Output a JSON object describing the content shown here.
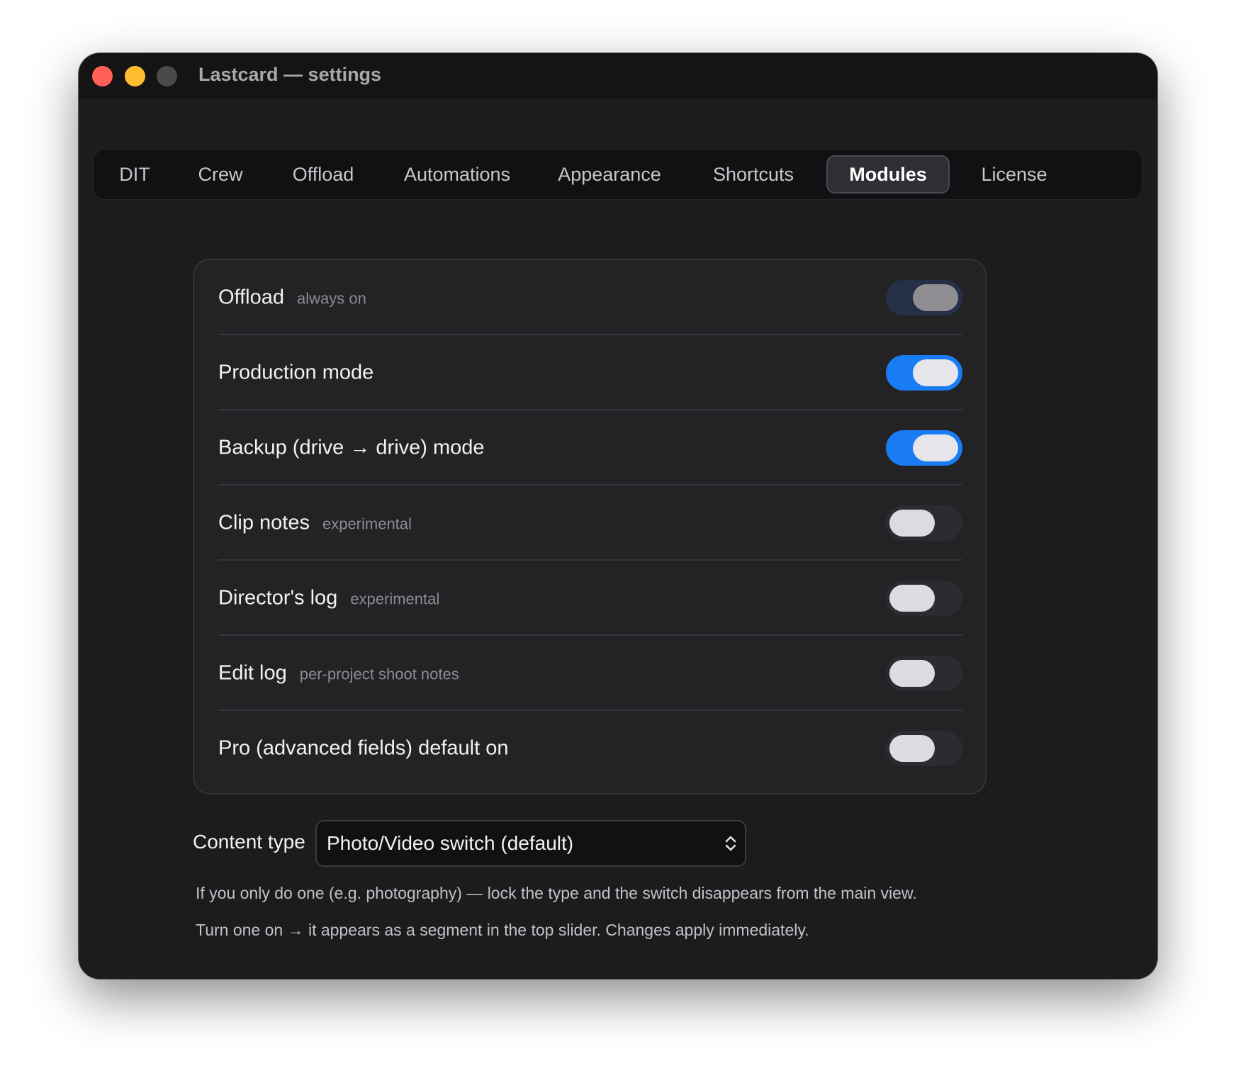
{
  "window": {
    "title": "Lastcard — settings"
  },
  "tabs": [
    {
      "label": "DIT",
      "active": false
    },
    {
      "label": "Crew",
      "active": false
    },
    {
      "label": "Offload",
      "active": false
    },
    {
      "label": "Automations",
      "active": false
    },
    {
      "label": "Appearance",
      "active": false
    },
    {
      "label": "Shortcuts",
      "active": false
    },
    {
      "label": "Modules",
      "active": true
    },
    {
      "label": "License",
      "active": false
    }
  ],
  "modules": [
    {
      "title": "Offload",
      "hint": "always on",
      "state": "locked-on"
    },
    {
      "title": "Production mode",
      "hint": "",
      "state": "on"
    },
    {
      "title": "Backup (drive → drive) mode",
      "hint": "",
      "state": "on"
    },
    {
      "title": "Clip notes",
      "hint": "experimental",
      "state": "off"
    },
    {
      "title": "Director's log",
      "hint": "experimental",
      "state": "off"
    },
    {
      "title": "Edit log",
      "hint": "per-project shoot notes",
      "state": "off"
    },
    {
      "title": "Pro (advanced fields) default on",
      "hint": "",
      "state": "off"
    }
  ],
  "content_type": {
    "label": "Content type",
    "selected": "Photo/Video switch (default)",
    "icon": "chevron-up-down-icon"
  },
  "notes": {
    "line1": "If you only do one (e.g. photography) — lock the type and the switch disappears from the main view.",
    "line2": "Turn one on → it appears as a segment in the top slider. Changes apply immediately."
  },
  "colors": {
    "accent": "#1a7cf5",
    "window_bg": "#1c1c1e",
    "close": "#ff5f57",
    "minimize": "#febc2e"
  }
}
